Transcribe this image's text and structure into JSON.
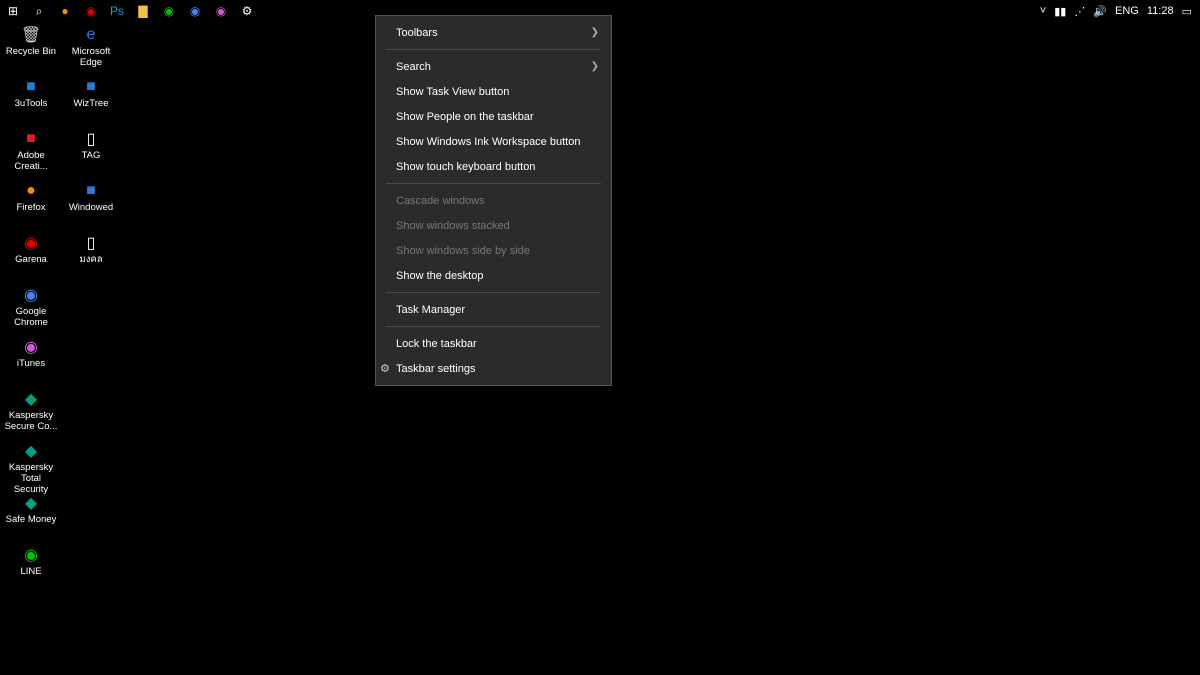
{
  "taskbar": {
    "left": [
      {
        "name": "start-button",
        "glyph": "⊞",
        "color": "#fff"
      },
      {
        "name": "search-icon",
        "glyph": "⌕",
        "color": "#fff"
      },
      {
        "name": "firefox-icon",
        "glyph": "●",
        "color": "#ff8c00"
      },
      {
        "name": "garena-icon",
        "glyph": "◉",
        "color": "#e30000"
      },
      {
        "name": "photoshop-icon",
        "glyph": "Ps",
        "color": "#0aa5d8"
      },
      {
        "name": "explorer-icon",
        "glyph": "▇",
        "color": "#f3c248"
      },
      {
        "name": "line-icon",
        "glyph": "◉",
        "color": "#00c300"
      },
      {
        "name": "chrome-icon",
        "glyph": "◉",
        "color": "#4285f4"
      },
      {
        "name": "itunes-icon",
        "glyph": "◉",
        "color": "#d058d6"
      },
      {
        "name": "settings-icon",
        "glyph": "⚙",
        "color": "#fff"
      }
    ],
    "right": {
      "chevron": "˅",
      "battery": "▮▮",
      "wifi": "⋰",
      "volume": "🔊",
      "lang": "ENG",
      "time": "11:28",
      "action_center": "▭"
    }
  },
  "desktop": {
    "col1": [
      {
        "label": "Recycle Bin",
        "icon": "🗑",
        "color": "#ccc"
      },
      {
        "label": "3uTools",
        "icon": "■",
        "color": "#1c7fd6"
      },
      {
        "label": "Adobe Creati...",
        "icon": "■",
        "color": "#da1f26"
      },
      {
        "label": "Firefox",
        "icon": "●",
        "color": "#ff8c00"
      },
      {
        "label": "Garena",
        "icon": "◉",
        "color": "#e30000"
      },
      {
        "label": "Google Chrome",
        "icon": "◉",
        "color": "#4285f4"
      },
      {
        "label": "iTunes",
        "icon": "◉",
        "color": "#d058d6"
      },
      {
        "label": "Kaspersky Secure Co...",
        "icon": "◆",
        "color": "#009e82"
      },
      {
        "label": "Kaspersky Total Security",
        "icon": "◆",
        "color": "#009e82"
      },
      {
        "label": "Safe Money",
        "icon": "◆",
        "color": "#009e82"
      },
      {
        "label": "LINE",
        "icon": "◉",
        "color": "#00c300"
      }
    ],
    "col2": [
      {
        "label": "Microsoft Edge",
        "icon": "e",
        "color": "#2b79d6"
      },
      {
        "label": "WizTree",
        "icon": "■",
        "color": "#2b79d6"
      },
      {
        "label": "TAG",
        "icon": "▯",
        "color": "#fff"
      },
      {
        "label": "Windowed",
        "icon": "■",
        "color": "#2b79d6"
      },
      {
        "label": "มงคล",
        "icon": "▯",
        "color": "#fff"
      }
    ]
  },
  "ctx": {
    "toolbars": "Toolbars",
    "search": "Search",
    "show_task_view": "Show Task View button",
    "show_people": "Show People on the taskbar",
    "show_wink": "Show Windows Ink Workspace button",
    "show_touch": "Show touch keyboard button",
    "cascade": "Cascade windows",
    "stacked": "Show windows stacked",
    "sidebyside": "Show windows side by side",
    "show_desktop": "Show the desktop",
    "task_manager": "Task Manager",
    "lock_taskbar": "Lock the taskbar",
    "taskbar_settings": "Taskbar settings"
  }
}
